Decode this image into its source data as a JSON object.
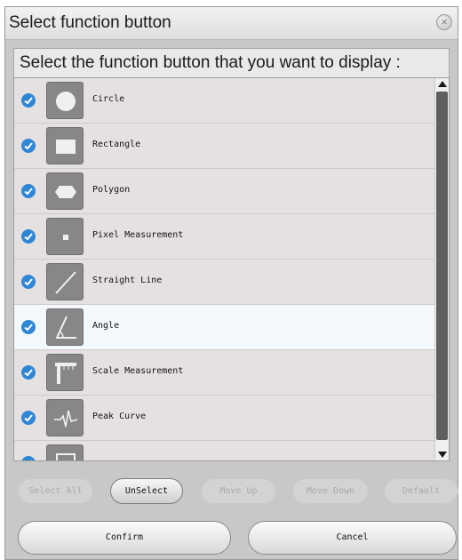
{
  "dialog": {
    "title": "Select function button",
    "close_glyph": "×",
    "prompt": "Select the function button that you want to display :"
  },
  "items": [
    {
      "label": "Circle",
      "icon": "circle-icon",
      "checked": true
    },
    {
      "label": "Rectangle",
      "icon": "rectangle-icon",
      "checked": true
    },
    {
      "label": "Polygon",
      "icon": "polygon-icon",
      "checked": true
    },
    {
      "label": "Pixel Measurement",
      "icon": "pixel-measurement-icon",
      "checked": true
    },
    {
      "label": "Straight Line",
      "icon": "straight-line-icon",
      "checked": true
    },
    {
      "label": "Angle",
      "icon": "angle-icon",
      "checked": true,
      "selected": true
    },
    {
      "label": "Scale Measurement",
      "icon": "scale-measurement-icon",
      "checked": true
    },
    {
      "label": "Peak Curve",
      "icon": "peak-curve-icon",
      "checked": true
    },
    {
      "label": "",
      "icon": "partial-item-icon",
      "checked": true
    }
  ],
  "buttons": {
    "select_all": "Select All",
    "unselect": "UnSelect",
    "move_up": "Move Up",
    "move_down": "Move Down",
    "default": "Default",
    "confirm": "Confirm",
    "cancel": "Cancel"
  },
  "colors": {
    "check": "#2f86d4",
    "selected_row": "#f3f8fc",
    "icon_tile": "#878787"
  }
}
